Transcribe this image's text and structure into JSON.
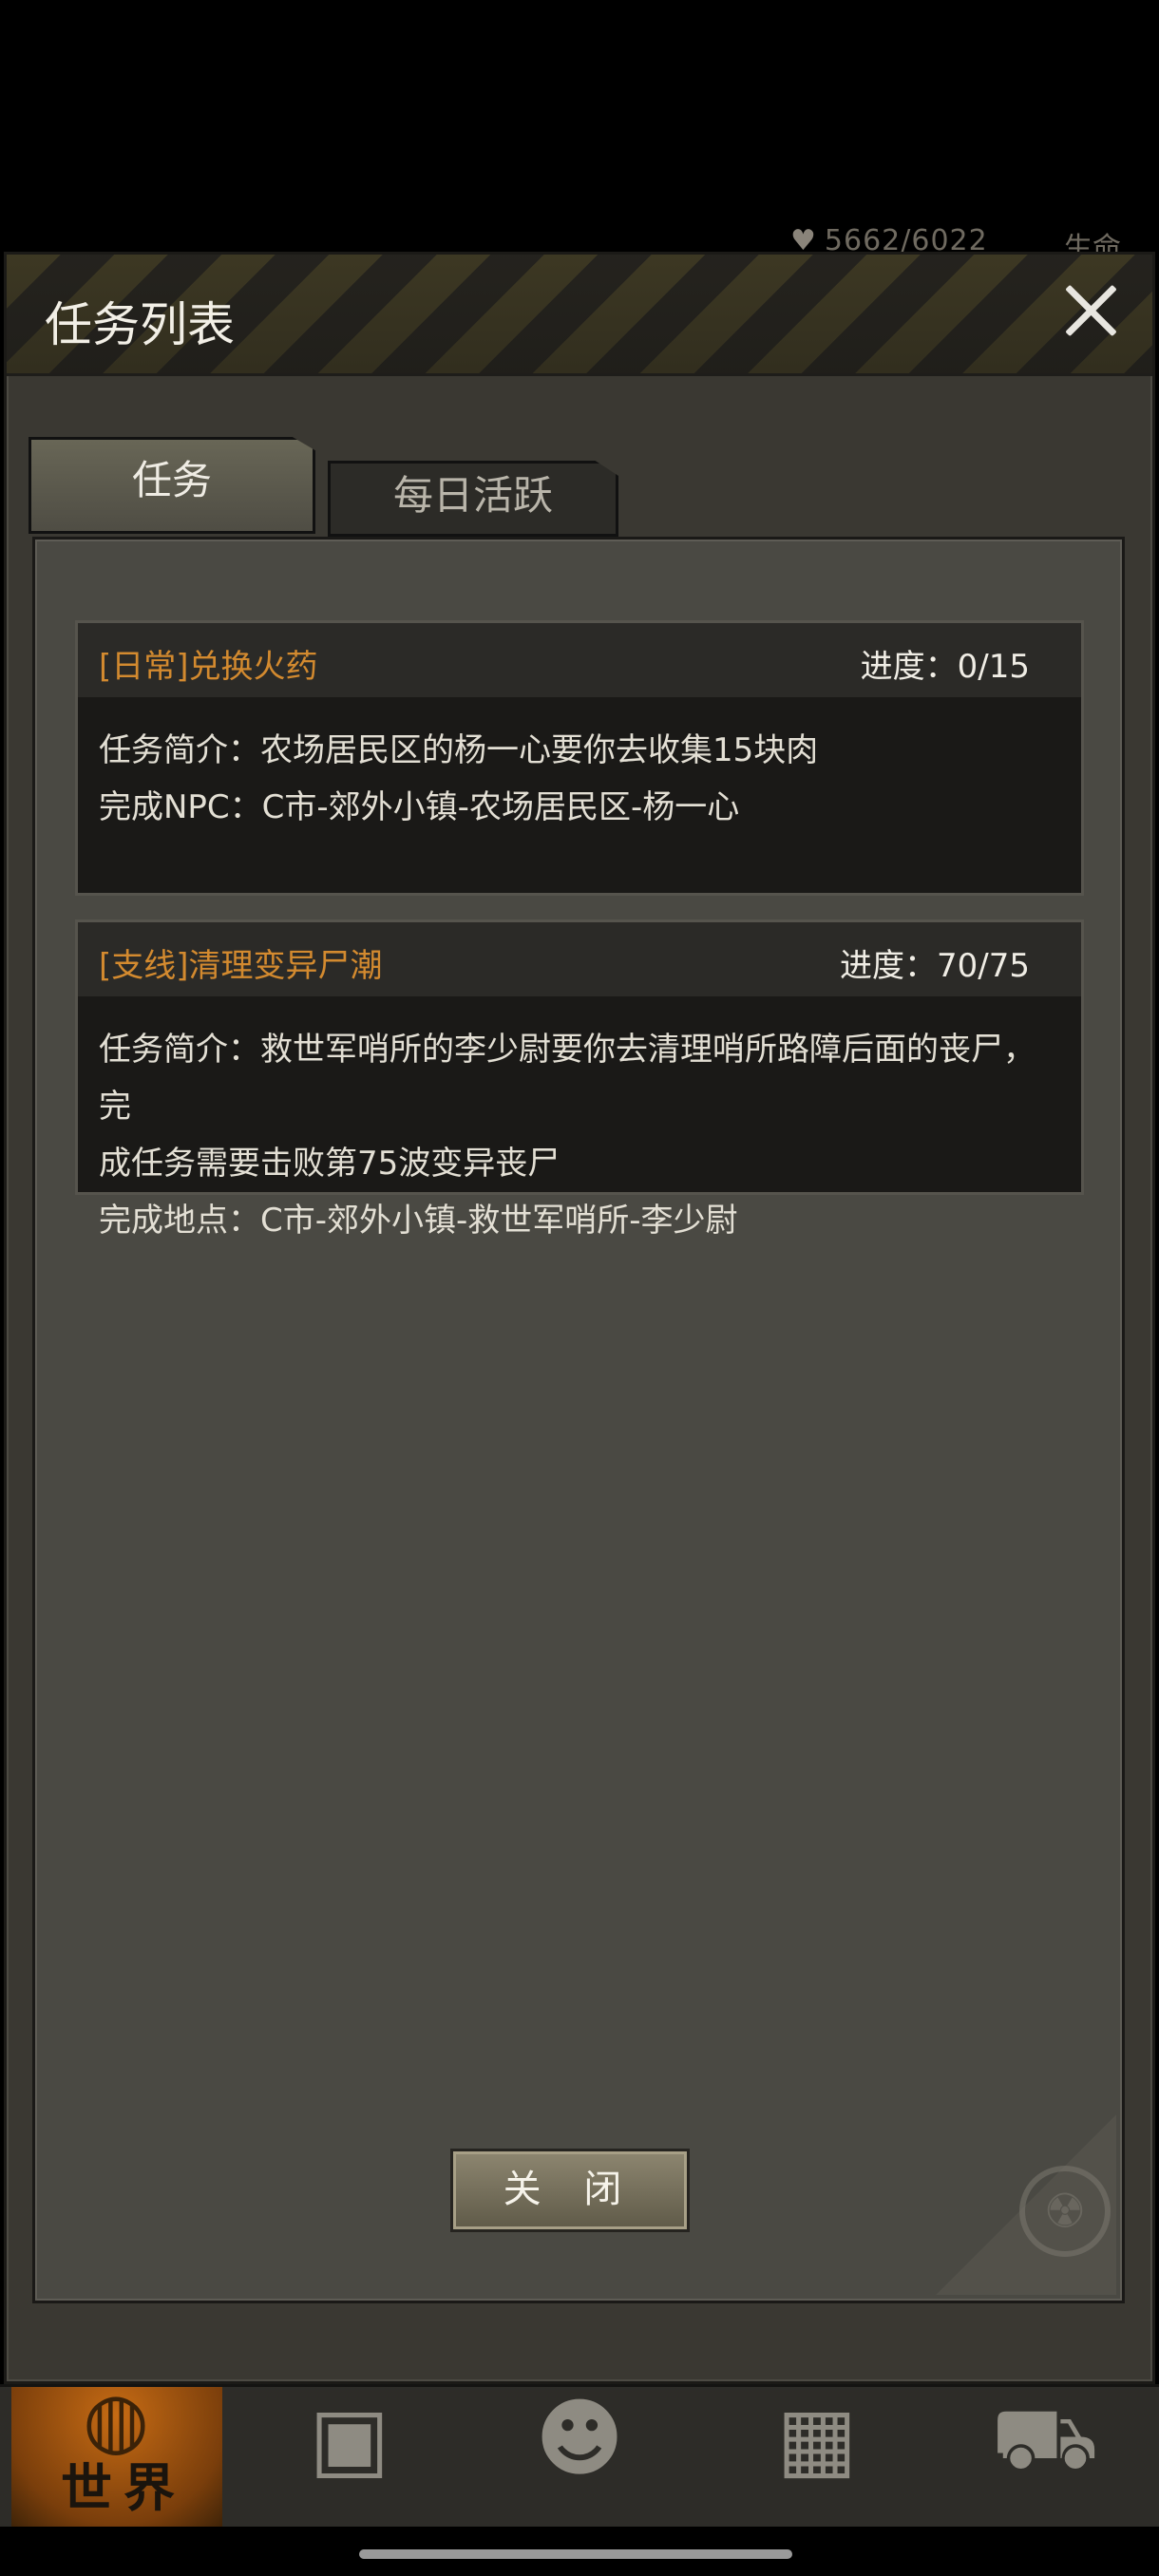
{
  "status": {
    "hp": "5662/6022",
    "life_label": "生命"
  },
  "dialog": {
    "title": "任务列表",
    "close_icon": "close-icon"
  },
  "tabs": [
    {
      "label": "任务",
      "active": true
    },
    {
      "label": "每日活跃",
      "active": false
    }
  ],
  "quests": [
    {
      "name": "[日常]兑换火药",
      "progress": "进度：0/15",
      "lines": [
        "任务简介：农场居民区的杨一心要你去收集15块肉",
        "完成NPC：C市-郊外小镇-农场居民区-杨一心"
      ]
    },
    {
      "name": "[支线]清理变异尸潮",
      "progress": "进度：70/75",
      "lines": [
        "任务简介：救世军哨所的李少尉要你去清理哨所路障后面的丧尸，完",
        "成任务需要击败第75波变异丧尸",
        "完成地点：C市-郊外小镇-救世军哨所-李少尉"
      ]
    }
  ],
  "close_button": "关 闭",
  "bottom_nav": {
    "world_label": "世界",
    "items": [
      "globe-icon",
      "backpack-icon",
      "character-head-icon",
      "building-icon",
      "shopping-cart-icon"
    ]
  },
  "colors": {
    "quest_name": "#d38a2f",
    "panel_bg": "#4a4943",
    "world_tab": "#c66b14"
  }
}
